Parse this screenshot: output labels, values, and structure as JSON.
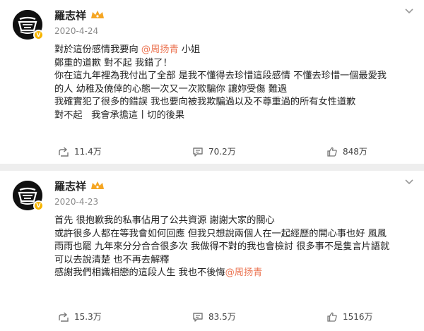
{
  "posts": [
    {
      "author": "羅志祥",
      "date": "2020-4-24",
      "content": {
        "line1_before": "對於這份感情我要向 ",
        "line1_mention": "@周扬青",
        "line1_after": " 小姐",
        "line2": "鄭重的道歉 對不起 我錯了！",
        "line3": "你在這九年裡為我付出了全部 是我不懂得去珍惜這段感情 不懂去珍惜一個最愛我",
        "line4": "的人 幼稚及僥倖的心態一次又一次欺騙你 讓妳受傷 難過",
        "line5": "我確實犯了很多的錯誤 我也要向被我欺騙過以及不尊重過的所有女性道歉",
        "line6": "對不起   我會承擔這丨切的後果"
      },
      "shares": "11.4万",
      "comments": "70.2万",
      "likes": "848万"
    },
    {
      "author": "羅志祥",
      "date": "2020-4-23",
      "content": {
        "line1": "首先 很抱歉我的私事佔用了公共資源 謝謝大家的關心",
        "line2": "或許很多人都在等我會如何回應 但我只想說兩個人在一起經歷的開心事也好 風風",
        "line3": "雨雨也罷 九年來分分合合很多次 我做得不對的我也會檢討 很多事不是隻言片語就",
        "line4": "可以去說清楚 也不再去解釋",
        "line5_before": "感謝我們相識相戀的這段人生 我也不後悔",
        "line5_mention": "@周扬青"
      },
      "shares": "15.3万",
      "comments": "83.5万",
      "likes": "1516万"
    }
  ],
  "icons": {
    "share": "share-icon",
    "comment": "comment-icon",
    "like": "like-icon",
    "more": "chevron-down-icon",
    "verified": "verified-badge-icon",
    "crown": "vip-crown-icon"
  },
  "colors": {
    "mention": "#eb7350",
    "verified": "#f7b500",
    "crown": "#f5a623",
    "date": "#8a8a8a"
  }
}
